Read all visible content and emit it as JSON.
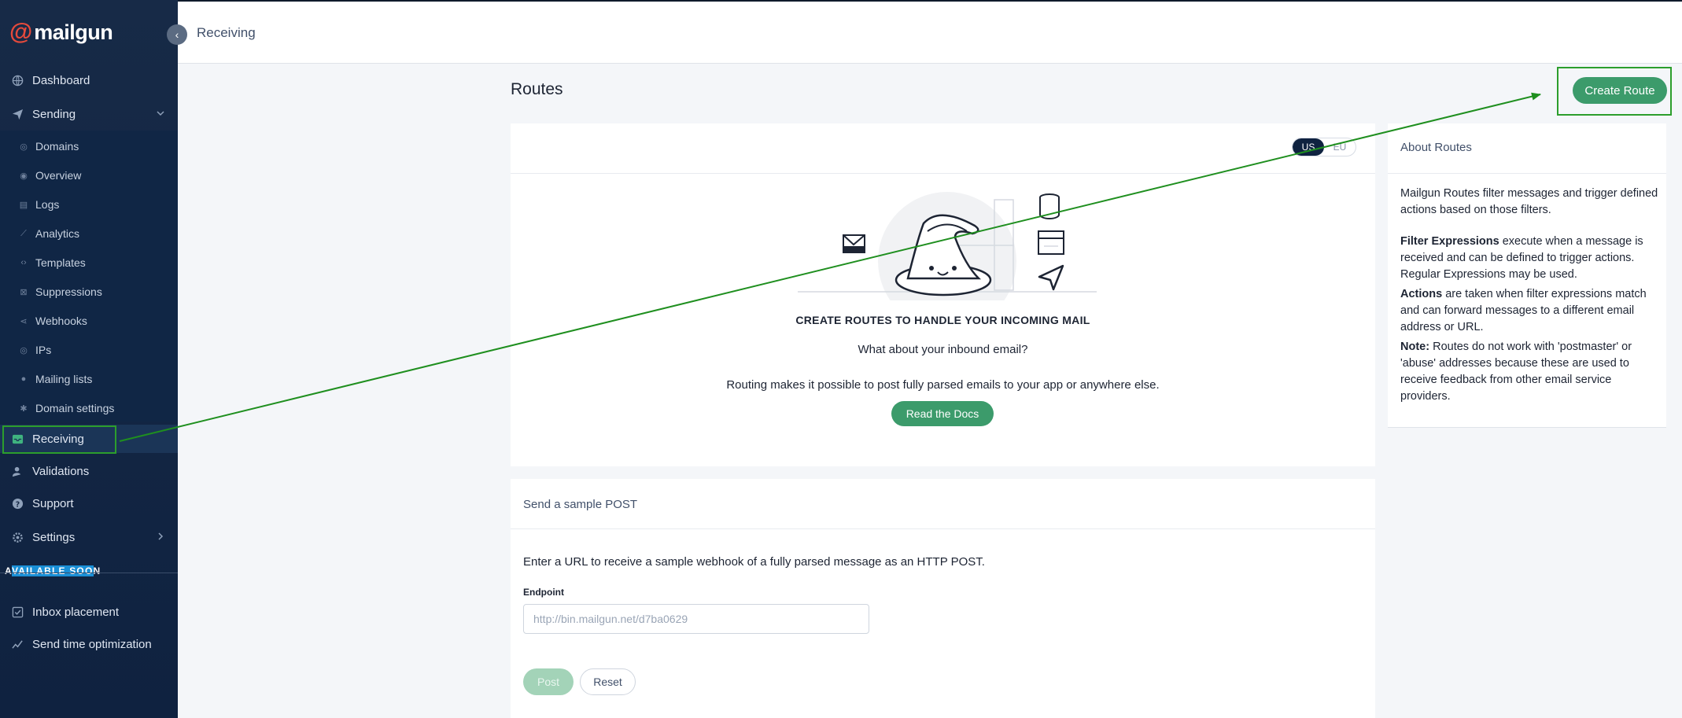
{
  "sidebar": {
    "logo_symbol": "@",
    "logo_text": "mailgun",
    "collapse_icon": "‹",
    "items": [
      {
        "label": "Dashboard",
        "icon": "globe-icon"
      },
      {
        "label": "Sending",
        "icon": "paper-plane-icon"
      },
      {
        "label": "Receiving",
        "icon": "inbox-icon"
      },
      {
        "label": "Validations",
        "icon": "user-check-icon"
      },
      {
        "label": "Support",
        "icon": "help-icon"
      },
      {
        "label": "Settings",
        "icon": "gear-icon"
      }
    ],
    "sending_sub": [
      {
        "label": "Domains"
      },
      {
        "label": "Overview"
      },
      {
        "label": "Logs"
      },
      {
        "label": "Analytics"
      },
      {
        "label": "Templates"
      },
      {
        "label": "Suppressions"
      },
      {
        "label": "Webhooks"
      },
      {
        "label": "IPs"
      },
      {
        "label": "Mailing lists"
      },
      {
        "label": "Domain settings"
      }
    ],
    "available_soon_a": "A",
    "available_soon_hl": "VAILABLE SOO",
    "available_soon_b": "N",
    "soon_items": [
      {
        "label": "Inbox placement"
      },
      {
        "label": "Send time optimization"
      }
    ]
  },
  "topbar": {
    "breadcrumb": "Receiving"
  },
  "main": {
    "title": "Routes",
    "create_button": "Create Route",
    "region": {
      "us": "US",
      "eu": "EU",
      "selected": "US"
    },
    "empty_heading": "CREATE ROUTES TO HANDLE YOUR INCOMING MAIL",
    "empty_question": "What about your inbound email?",
    "empty_desc": "Routing makes it possible to post fully parsed emails to your app or anywhere else.",
    "docs_button": "Read the Docs"
  },
  "sample": {
    "title": "Send a sample POST",
    "intro": "Enter a URL to receive a sample webhook of a fully parsed message as an HTTP POST.",
    "endpoint_label": "Endpoint",
    "endpoint_placeholder": "http://bin.mailgun.net/d7ba0629",
    "post_button": "Post",
    "reset_button": "Reset"
  },
  "about": {
    "title": "About Routes",
    "intro": "Mailgun Routes filter messages and trigger defined actions based on those filters.",
    "filter_bold": "Filter Expressions",
    "filter_text": " execute when a message is received and can be defined to trigger actions. Regular Expressions may be used.",
    "actions_bold": "Actions",
    "actions_text": " are taken when filter expressions match and can forward messages to a different email address or URL.",
    "note_bold": "Note:",
    "note_text": " Routes do not work with 'postmaster' or 'abuse' addresses because these are used to receive feedback from other email service providers."
  },
  "colors": {
    "accent_green": "#3c9b6b",
    "sidebar_bg": "#172a47",
    "annotation_green": "#2c9e2c",
    "logo_red": "#e44a3c"
  }
}
